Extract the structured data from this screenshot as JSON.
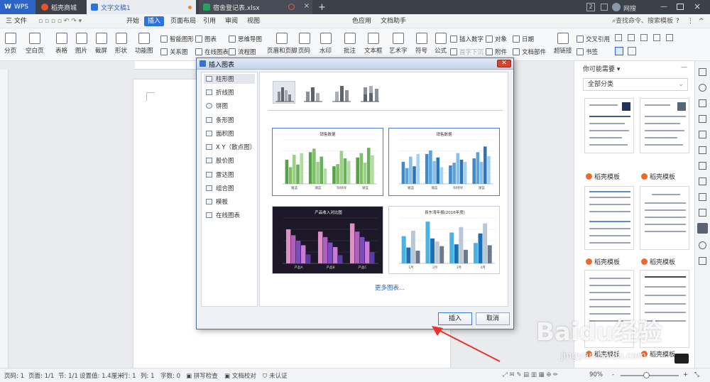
{
  "tabs": [
    {
      "label": "WPS"
    },
    {
      "label": "稻壳商城"
    },
    {
      "label": "文字文稿1"
    },
    {
      "label": "宿舍登记表.xlsx"
    }
  ],
  "tab_new": "+",
  "window_badge": "2",
  "user_name": "网搜",
  "menu": {
    "file": "三 文件",
    "items": [
      "开始",
      "插入",
      "页面布局",
      "引用",
      "审阅",
      "视图",
      "色应用",
      "文档助手"
    ],
    "search": "查找命令、搜索模板",
    "help": "?"
  },
  "ribbon": {
    "large": [
      "分页",
      "空白页",
      "表格",
      "图片",
      "截屏",
      "形状",
      "功能图",
      "页眉和页脚",
      "页码",
      "水印",
      "批注",
      "文本框",
      "艺术字",
      "符号",
      "公式",
      "超链接"
    ],
    "small": [
      "智能图形",
      "关系图",
      "图表",
      "在线图表",
      "思维导图",
      "流程图",
      "插入数字",
      "首字下沉",
      "对象",
      "附件",
      "日期",
      "文档部件",
      "交叉引用",
      "书签"
    ]
  },
  "dialog": {
    "title": "插入图表",
    "categories": [
      "柱形图",
      "折线图",
      "饼图",
      "条形图",
      "面积图",
      "X Y（散点图）",
      "股价图",
      "雷达图",
      "组合图",
      "模板",
      "在线图表"
    ],
    "more_link": "更多图表...",
    "insert_button": "插入",
    "cancel_button": "取消",
    "thumb_titles": [
      "销售数据",
      "销售数据",
      "产品收入对比图",
      "县东湾年报(2016年度)"
    ],
    "thumb1_xlabels": [
      "雅蓝",
      "瀚蓝",
      "阳绿绿",
      "湖蓝"
    ],
    "thumb2_xlabels": [
      "雅蓝",
      "瀚蓝",
      "阳绿绿",
      "湖蓝"
    ],
    "thumb3_xlabels": [
      "产品A",
      "产品B",
      "产品C"
    ],
    "thumb4_xlabels": [
      "1月",
      "2月",
      "3月",
      "4月"
    ]
  },
  "right_panel": {
    "title": "你可能需要 ▾",
    "category_select": "全部分类",
    "template_label": "稻壳模板",
    "template_labels": [
      "稻壳模板",
      "稻壳模板",
      "稻壳模板",
      "稻壳模板",
      "稻壳模板",
      "稻壳模板"
    ]
  },
  "status": {
    "page_num": "页码: 1",
    "pages": "页面: 1/1",
    "section": "节: 1/1",
    "setting": "设置值: 1.4厘米",
    "row": "行: 1",
    "col": "列: 1",
    "words": "字数: 0",
    "spellcheck": "拼写检查",
    "proofread": "文档校对",
    "cert": "未认证",
    "zoom": "90%",
    "zoom_minus": "-",
    "zoom_plus": "+"
  },
  "watermark": {
    "main": "Baidu经验",
    "sub": "jingyan.baidu.com"
  },
  "colors": {
    "accent": "#2e73d9",
    "tabbar": "#3b4049",
    "green_bars": "#7fbf6a",
    "blue_bars": "#5ba2d9",
    "dark_bg": "#1c1828",
    "arrow": "#e5352d"
  },
  "chart_data": [
    {
      "type": "bar",
      "title": "销售数据",
      "categories": [
        "雅蓝",
        "瀚蓝",
        "阳绿绿",
        "湖蓝"
      ],
      "series": [
        {
          "values": [
            55,
            72,
            40,
            60
          ]
        },
        {
          "values": [
            38,
            80,
            45,
            70
          ]
        },
        {
          "values": [
            66,
            50,
            75,
            48
          ]
        },
        {
          "values": [
            44,
            62,
            58,
            82
          ]
        },
        {
          "values": [
            70,
            35,
            52,
            65
          ]
        }
      ],
      "ylim": [
        0,
        100
      ]
    },
    {
      "type": "bar",
      "title": "销售数据",
      "categories": [
        "雅蓝",
        "瀚蓝",
        "阳绿绿",
        "湖蓝"
      ],
      "series": [
        {
          "values": [
            50,
            68,
            42,
            58
          ]
        },
        {
          "values": [
            36,
            76,
            48,
            72
          ]
        },
        {
          "values": [
            62,
            52,
            70,
            50
          ]
        },
        {
          "values": [
            40,
            60,
            55,
            85
          ]
        },
        {
          "values": [
            68,
            38,
            50,
            63
          ]
        }
      ],
      "ylim": [
        0,
        100
      ]
    },
    {
      "type": "bar",
      "title": "产品收入对比图",
      "categories": [
        "产品A",
        "产品B",
        "产品C"
      ],
      "series": [
        {
          "values": [
            75,
            70,
            88
          ]
        },
        {
          "values": [
            62,
            58,
            70
          ]
        },
        {
          "values": [
            50,
            46,
            58
          ]
        },
        {
          "values": [
            40,
            36,
            48
          ]
        },
        {
          "values": [
            20,
            18,
            25
          ]
        }
      ],
      "ylim": [
        0,
        100
      ]
    },
    {
      "type": "bar",
      "title": "县东湾年报(2016年度)",
      "categories": [
        "1月",
        "2月",
        "3月",
        "4月"
      ],
      "series": [
        {
          "values": [
            60,
            92,
            68,
            45
          ]
        },
        {
          "values": [
            35,
            55,
            42,
            66
          ]
        },
        {
          "values": [
            72,
            48,
            80,
            88
          ]
        },
        {
          "values": [
            28,
            38,
            30,
            40
          ]
        }
      ],
      "ylim": [
        0,
        100
      ]
    }
  ]
}
